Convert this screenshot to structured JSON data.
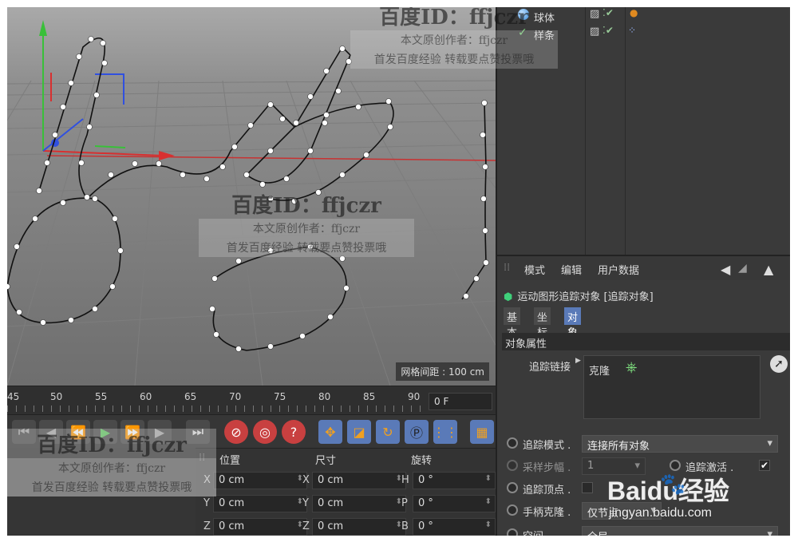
{
  "objects": [
    {
      "name": "球体",
      "icon": "sphere-icon",
      "checked": true
    },
    {
      "name": "样条",
      "icon": "spline-icon",
      "checked": true
    }
  ],
  "viewport": {
    "grid_spacing": "网格间距 : 100 cm"
  },
  "timeline": {
    "ticks": [
      "45",
      "50",
      "55",
      "60",
      "65",
      "70",
      "75",
      "80",
      "85",
      "90"
    ],
    "current_frame": "0 F"
  },
  "coords": {
    "headers": {
      "position": "位置",
      "size": "尺寸",
      "rotation": "旋转"
    },
    "rows": [
      {
        "axis1": "X",
        "pos": "0 cm",
        "axis2": "X",
        "size": "0 cm",
        "axis3": "H",
        "rot": "0 °"
      },
      {
        "axis1": "Y",
        "pos": "0 cm",
        "axis2": "Y",
        "size": "0 cm",
        "axis3": "P",
        "rot": "0 °"
      },
      {
        "axis1": "Z",
        "pos": "0 cm",
        "axis2": "Z",
        "size": "0 cm",
        "axis3": "B",
        "rot": "0 °"
      }
    ]
  },
  "attributes": {
    "menu": {
      "mode": "模式",
      "edit": "编辑",
      "user_data": "用户数据"
    },
    "object_title": "运动图形追踪对象 [追踪对象]",
    "tabs": {
      "basic": "基本",
      "coord": "坐标",
      "object": "对象"
    },
    "section_title": "对象属性",
    "trace_link_label": "追踪链接",
    "trace_link_value": "克隆",
    "trace_mode_label": "追踪模式 .",
    "trace_mode_value": "连接所有对象",
    "sample_step_label": "采样步幅 .",
    "sample_step_value": "1",
    "trace_active_label": "追踪激活 .",
    "trace_vertex_label": "追踪顶点 .",
    "handle_clone_label": "手柄克隆 .",
    "handle_clone_value": "仅节点",
    "space_label": "空间 . . . . .",
    "space_value": "全局"
  },
  "watermarks": {
    "id_text": "百度ID：ffjczr",
    "author": "本文原创作者：ffjczr",
    "notice": "首发百度经验 转载要点赞投票哦"
  },
  "baidu_logo": {
    "text": "Baidu经验",
    "url": "jingyan.baidu.com"
  }
}
